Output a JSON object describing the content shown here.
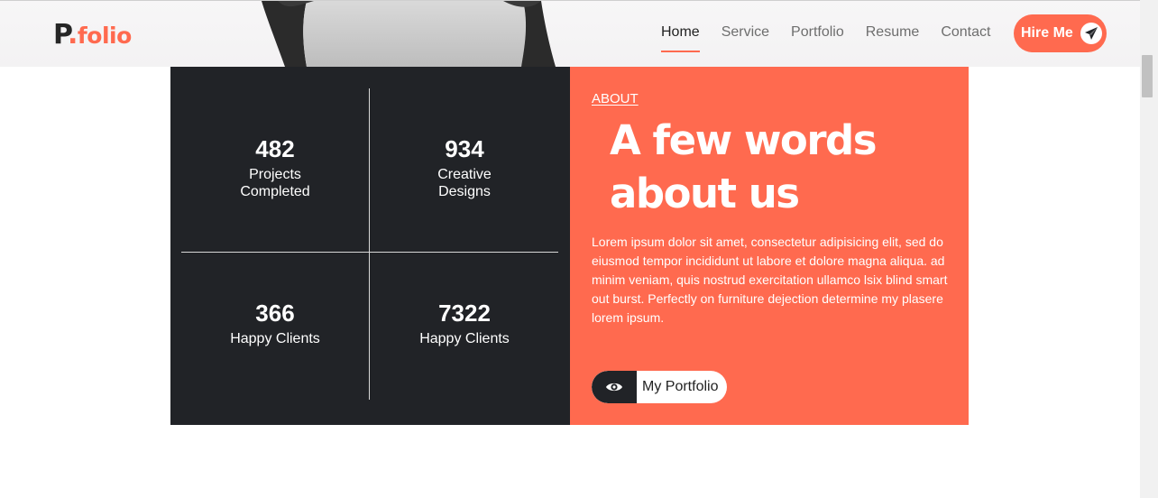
{
  "header": {
    "logo": {
      "letter": "P",
      "dot": ".",
      "word": "folio"
    },
    "nav": [
      {
        "label": "Home",
        "active": true
      },
      {
        "label": "Service",
        "active": false
      },
      {
        "label": "Portfolio",
        "active": false
      },
      {
        "label": "Resume",
        "active": false
      },
      {
        "label": "Contact",
        "active": false
      }
    ],
    "hire_button": {
      "label": "Hire Me",
      "icon": "paper-plane-icon"
    }
  },
  "stats": [
    {
      "number": "482",
      "label": "Projects Completed"
    },
    {
      "number": "934",
      "label": "Creative Designs"
    },
    {
      "number": "366",
      "label": "Happy Clients"
    },
    {
      "number": "7322",
      "label": "Happy Clients"
    }
  ],
  "about": {
    "eyebrow": "ABOUT",
    "title": "A few words about us",
    "text": "Lorem ipsum dolor sit amet, consectetur adipisicing elit, sed do eiusmod tempor incididunt ut labore et dolore magna aliqua. ad minim veniam, quis nostrud exercitation ullamco lsix blind smart out burst. Perfectly on furniture dejection determine my plasere lorem ipsum.",
    "button": {
      "label": "My Portfolio",
      "icon": "eye-icon"
    }
  },
  "colors": {
    "accent": "#ff6a4f",
    "dark": "#212327",
    "header_bg": "#f5f4f5"
  }
}
